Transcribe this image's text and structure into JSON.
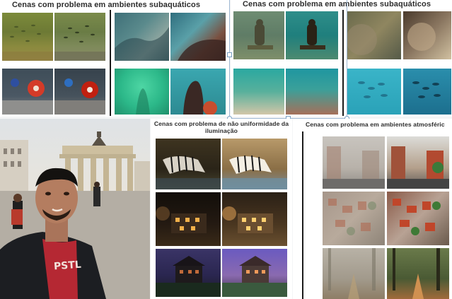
{
  "slide": {
    "title_left": "Cenas com problema em ambientes subaquáticos",
    "title_right": "Cenas com problema em ambientes subaquáticos",
    "title_illumination": "Cenas com problema de não uniformidade da iluminação",
    "title_atmospheric": "Cenas com problema em ambientes atmosféric",
    "shirt_text": "PSTL"
  },
  "colors": {
    "panel_bg": "#ffffff",
    "title_text": "#2d2d2d",
    "divider": "#1b1b1b",
    "selection_handle": "#7aa0c4"
  }
}
